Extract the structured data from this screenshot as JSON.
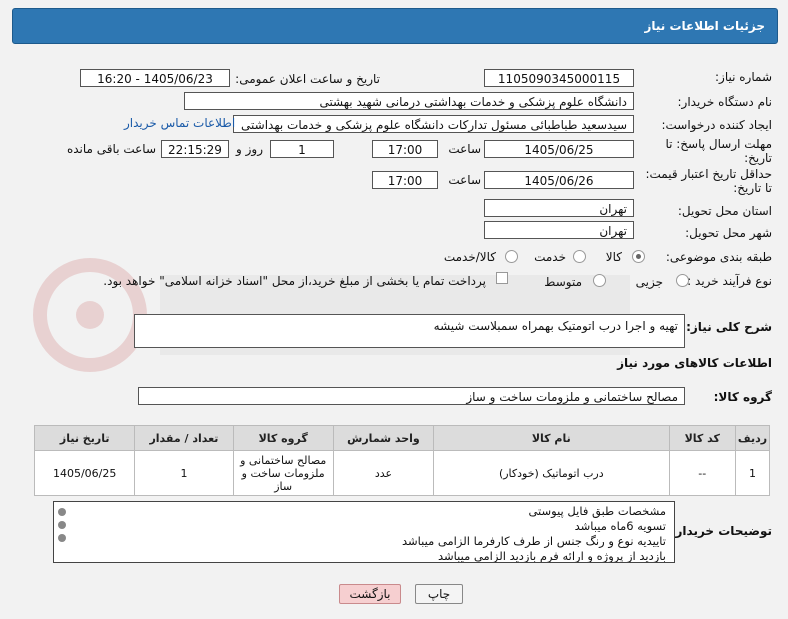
{
  "header": {
    "title": "جزئیات اطلاعات نیاز"
  },
  "fields": {
    "need_number_label": "شماره نیاز:",
    "need_number": "1105090345000115",
    "announce_label": "تاریخ و ساعت اعلان عمومی:",
    "announce_value": "1405/06/23 - 16:20",
    "buyer_org_label": "نام دستگاه خریدار:",
    "buyer_org": "دانشگاه علوم پزشکی و خدمات بهداشتی درمانی شهید بهشتی",
    "requester_label": "ایجاد کننده درخواست:",
    "requester": "سیدسعید طباطبائی مسئول تدارکات دانشگاه علوم پزشکی و خدمات بهداشتی",
    "contact_link": "اطلاعات تماس خریدار",
    "deadline_label_1": "مهلت ارسال پاسخ: تا",
    "deadline_label_2": "تاریخ:",
    "deadline_date": "1405/06/25",
    "time_label": "ساعت",
    "deadline_time": "17:00",
    "days_value": "1",
    "day_word": "روز و",
    "remaining_time": "22:15:29",
    "remaining_label": "ساعت باقی مانده",
    "min_validity_label_1": "حداقل تاریخ اعتبار قیمت:",
    "min_validity_label_2": "تا تاریخ:",
    "validity_date": "1405/06/26",
    "validity_time": "17:00",
    "province_label": "استان محل تحویل:",
    "province": "تهران",
    "city_label": "شهر محل تحویل:",
    "city": "تهران",
    "category_label": "طبقه بندی موضوعی:",
    "category_options": [
      "کالا",
      "خدمت",
      "کالا/خدمت"
    ],
    "process_label": "نوع فرآیند خرید :",
    "process_options": [
      "جزیی",
      "متوسط"
    ],
    "payment_note": "پرداخت تمام یا بخشی از مبلغ خرید،از محل \"اسناد خزانه اسلامی\" خواهد بود.",
    "summary_label": "شرح کلی نیاز:",
    "summary": "تهیه و اجرا درب اتومتیک بهمراه سمبلاست شیشه",
    "goods_info_title": "اطلاعات کالاهای مورد نیاز",
    "goods_group_label": "گروه کالا:",
    "goods_group": "مصالح ساختمانی و ملزومات ساخت و ساز"
  },
  "table": {
    "headers": [
      "ردیف",
      "کد کالا",
      "نام کالا",
      "واحد شمارش",
      "گروه کالا",
      "تعداد / مقدار",
      "تاریخ نیاز"
    ],
    "rows": [
      [
        "1",
        "--",
        "درب اتوماتیک (خودکار)",
        "عدد",
        "مصالح ساختمانی و ملزومات ساخت و ساز",
        "1",
        "1405/06/25"
      ]
    ]
  },
  "notes": {
    "label": "توضیحات خریدار:",
    "lines": [
      "مشخصات طبق فایل پیوستی",
      "تسویه 6ماه میباشد",
      "تاییدیه نوع و رنگ جنس از طرف کارفرما الزامی میباشد",
      "بازدید از پروژه و ارائه فرم بازدید الزامی میباشد"
    ]
  },
  "buttons": {
    "print": "چاپ",
    "back": "بازگشت"
  },
  "colors": {
    "header": "#2e77b3",
    "link": "#1a5aa8",
    "back_button": "#f6cfd0"
  }
}
